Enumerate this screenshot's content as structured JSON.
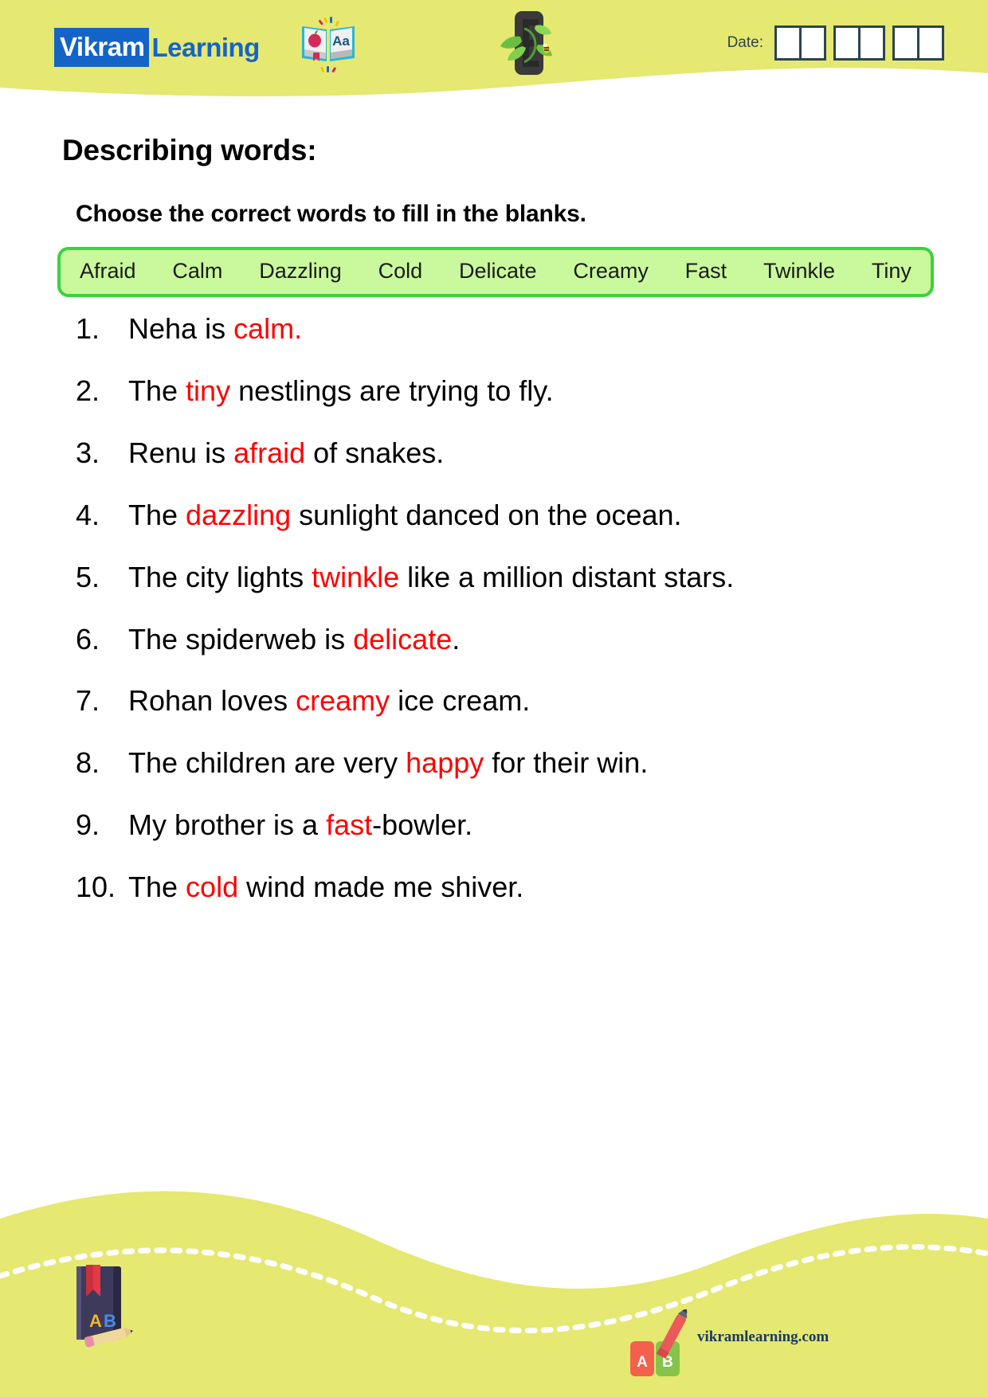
{
  "header": {
    "brand_badge": "Vikram",
    "brand_word": "Learning",
    "brand_badge_color": "#1464c8",
    "band_color": "#e5e871",
    "book_icon_name": "open-book-apple-aa-icon",
    "book_icon_letters": "Aa",
    "leaf_icon_name": "green-leaf-letter-icon",
    "date_label": "Date:",
    "date_groups": [
      {
        "cells": [
          "",
          ""
        ]
      },
      {
        "cells": [
          "",
          ""
        ]
      },
      {
        "cells": [
          "",
          ""
        ]
      }
    ]
  },
  "worksheet": {
    "title": "Describing words:",
    "instruction": "Choose the correct words to fill in the blanks.",
    "wordbank": {
      "border_color": "#3ad33a",
      "fill_color": "#c9f99c",
      "words": [
        "Afraid",
        "Calm",
        "Dazzling",
        "Cold",
        "Delicate",
        "Creamy",
        "Fast",
        "Twinkle",
        "Tiny"
      ]
    },
    "answer_color": "#ff0000",
    "questions": [
      {
        "number": "1.",
        "before": "Neha is ",
        "answer": "calm.",
        "after": "",
        "full": "Neha is calm."
      },
      {
        "number": "2.",
        "before": "The ",
        "answer": "tiny",
        "after": " nestlings are trying to fly.",
        "full": "The tiny nestlings are trying to fly."
      },
      {
        "number": "3.",
        "before": " Renu is ",
        "answer": "afraid",
        "after": " of snakes.",
        "full": "Renu is afraid of snakes."
      },
      {
        "number": "4.",
        "before": " The ",
        "answer": "dazzling",
        "after": " sunlight danced on the ocean.",
        "full": "The dazzling sunlight danced on the ocean."
      },
      {
        "number": "5.",
        "before": " The city lights ",
        "answer": "twinkle",
        "after": " like a million distant stars.",
        "full": "The city lights twinkle like a million distant stars."
      },
      {
        "number": "6.",
        "before": " The spiderweb is ",
        "answer": "delicate",
        "after": ".",
        "full": "The spiderweb is delicate."
      },
      {
        "number": "7.",
        "before": " Rohan loves ",
        "answer": "creamy",
        "after": " ice cream.",
        "full": "Rohan loves creamy ice cream."
      },
      {
        "number": "8.",
        "before": " The children are very ",
        "answer": "happy",
        "after": " for their win.",
        "full": "The children are very happy for their win."
      },
      {
        "number": "9.",
        "before": " My brother is a ",
        "answer": "fast",
        "after": "-bowler.",
        "full": "My brother is a fast-bowler."
      },
      {
        "number": "10.",
        "before": " The ",
        "answer": "cold",
        "after": "  wind made me shiver.",
        "full": "The cold wind made me shiver."
      }
    ]
  },
  "footer": {
    "band_color": "#e5e871",
    "website": "vikramlearning.com",
    "book_icon_name": "ab-notebook-pencil-icon",
    "book_icon_letters": [
      "A",
      "B"
    ],
    "ab_icon_name": "ab-blocks-pencil-icon",
    "ab_icon_letters": [
      "A",
      "B"
    ]
  }
}
